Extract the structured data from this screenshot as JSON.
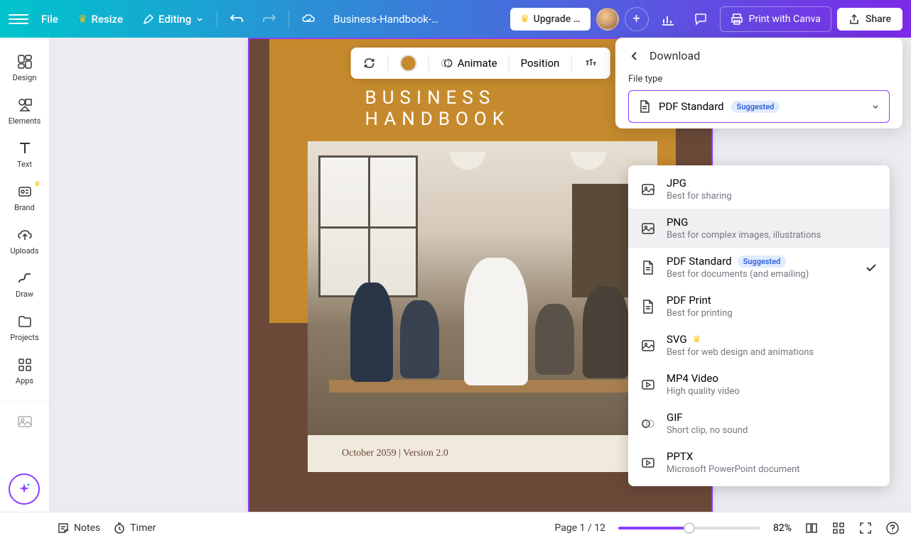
{
  "topbar": {
    "file": "File",
    "resize": "Resize",
    "editing": "Editing",
    "docTitle": "Business-Handbook-…",
    "upgrade": "Upgrade …",
    "print": "Print with Canva",
    "share": "Share"
  },
  "sidebar": {
    "items": [
      {
        "label": "Design"
      },
      {
        "label": "Elements"
      },
      {
        "label": "Text"
      },
      {
        "label": "Brand"
      },
      {
        "label": "Uploads"
      },
      {
        "label": "Draw"
      },
      {
        "label": "Projects"
      },
      {
        "label": "Apps"
      }
    ]
  },
  "floatToolbar": {
    "animate": "Animate",
    "position": "Position"
  },
  "page": {
    "titleTop": "Business",
    "subtitle": "BUSINESS HANDBOOK",
    "caption": "October 2059 | Version 2.0"
  },
  "download": {
    "title": "Download",
    "fileTypeLabel": "File type",
    "selected": "PDF Standard",
    "suggested": "Suggested",
    "options": [
      {
        "name": "JPG",
        "desc": "Best for sharing"
      },
      {
        "name": "PNG",
        "desc": "Best for complex images, illustrations"
      },
      {
        "name": "PDF Standard",
        "desc": "Best for documents (and emailing)",
        "suggested": true,
        "checked": true
      },
      {
        "name": "PDF Print",
        "desc": "Best for printing"
      },
      {
        "name": "SVG",
        "desc": "Best for web design and animations",
        "premium": true
      },
      {
        "name": "MP4 Video",
        "desc": "High quality video"
      },
      {
        "name": "GIF",
        "desc": "Short clip, no sound"
      },
      {
        "name": "PPTX",
        "desc": "Microsoft PowerPoint document"
      }
    ]
  },
  "footer": {
    "notes": "Notes",
    "timer": "Timer",
    "pageInfo": "Page 1 / 12",
    "zoom": "82%"
  }
}
